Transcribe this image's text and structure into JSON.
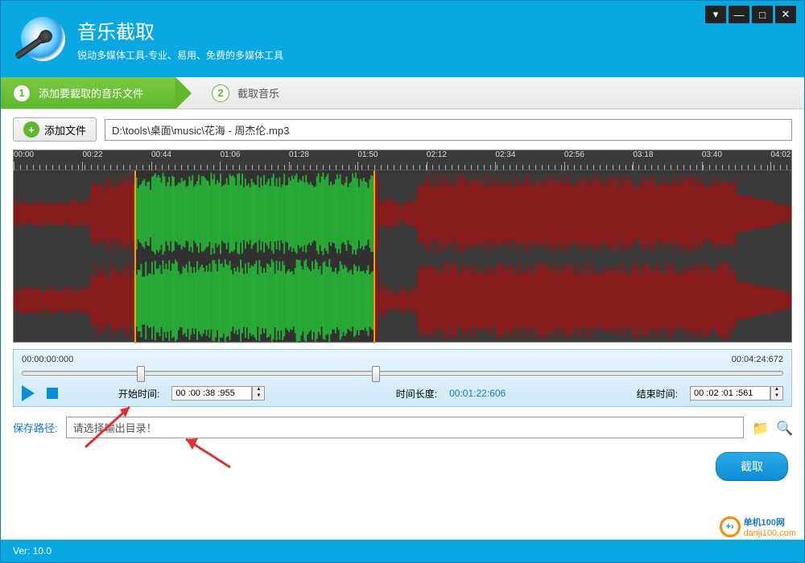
{
  "header": {
    "title": "音乐截取",
    "subtitle": "锐动多媒体工具-专业、易用、免费的多媒体工具"
  },
  "steps": {
    "s1_num": "1",
    "s1_label": "添加要截取的音乐文件",
    "s2_num": "2",
    "s2_label": "截取音乐"
  },
  "toolbar": {
    "add_label": "添加文件",
    "filepath": "D:\\tools\\桌面\\music\\花海 - 周杰伦.mp3"
  },
  "ruler_ticks": [
    "00:00",
    "00:22",
    "00:44",
    "01:06",
    "01:28",
    "01:50",
    "02:12",
    "02:34",
    "02:56",
    "03:18",
    "03:40",
    "04:02"
  ],
  "timeline": {
    "current": "00:00:00:000",
    "total": "00:04:24:672",
    "start_label": "开始时间:",
    "start_value": "00 :00 :38 :955",
    "length_label": "时间长度:",
    "length_value": "00:01:22:606",
    "end_label": "结束时间:",
    "end_value": "00 :02 :01 :561"
  },
  "save": {
    "label": "保存路径:",
    "placeholder": "请选择输出目录！"
  },
  "actions": {
    "extract": "截取"
  },
  "footer": {
    "version": "Ver: 10.0"
  },
  "watermark": {
    "site": "单机100网",
    "url": "danji100.com"
  },
  "selection": {
    "left_pct": 15.5,
    "width_pct": 31
  }
}
